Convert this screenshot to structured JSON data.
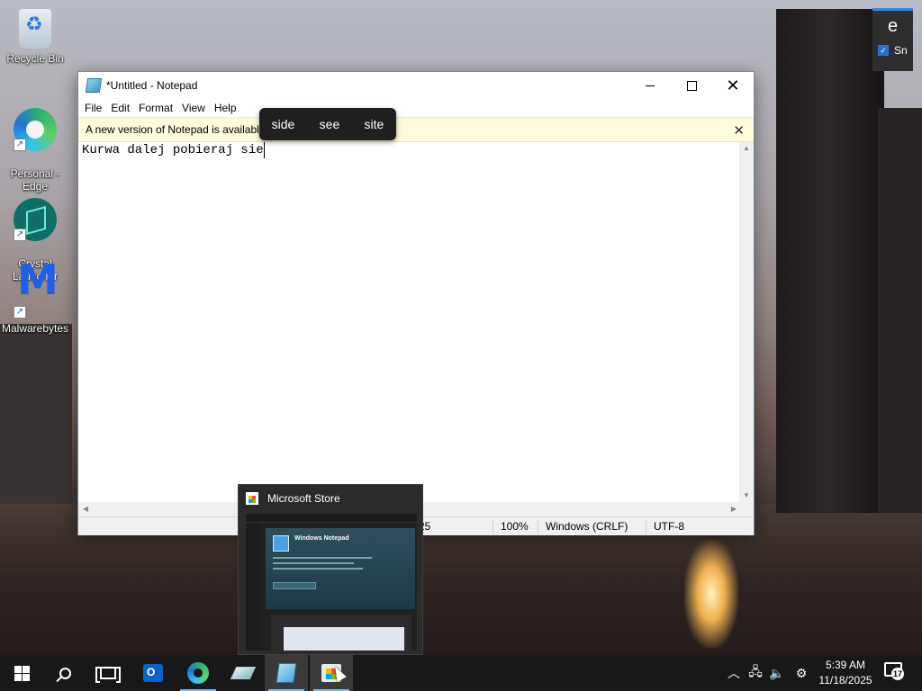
{
  "desktop": {
    "icons": [
      {
        "label": "Recycle Bin",
        "icon": "recycle-bin-icon"
      },
      {
        "label": "Personal -\nEdge",
        "icon": "edge-icon"
      },
      {
        "label": "Crystal\nLauncher",
        "icon": "crystal-launcher-icon"
      },
      {
        "label": "Malwarebytes",
        "icon": "malwarebytes-icon"
      }
    ]
  },
  "notepad": {
    "title": "*Untitled - Notepad",
    "menu": [
      "File",
      "Edit",
      "Format",
      "View",
      "Help"
    ],
    "banner_text": "A new version of Notepad is available",
    "banner_close": "✕",
    "content": "Kurwa dalej pobieraj sie",
    "status": {
      "position_fragment": "25",
      "zoom": "100%",
      "line_ending": "Windows (CRLF)",
      "encoding": "UTF-8"
    }
  },
  "ime_suggestions": [
    "side",
    "see",
    "site"
  ],
  "taskbar_preview": {
    "title": "Microsoft Store",
    "thumb_app_title": "Windows Notepad"
  },
  "notification": {
    "letter": "e",
    "item_label": "Sn"
  },
  "tray": {
    "time": "5:39 AM",
    "date": "11/18/2025",
    "notification_count": "17"
  },
  "colors": {
    "banner_bg": "#fffbdc",
    "taskbar_bg": "#181818",
    "accent": "#76b9ed"
  }
}
